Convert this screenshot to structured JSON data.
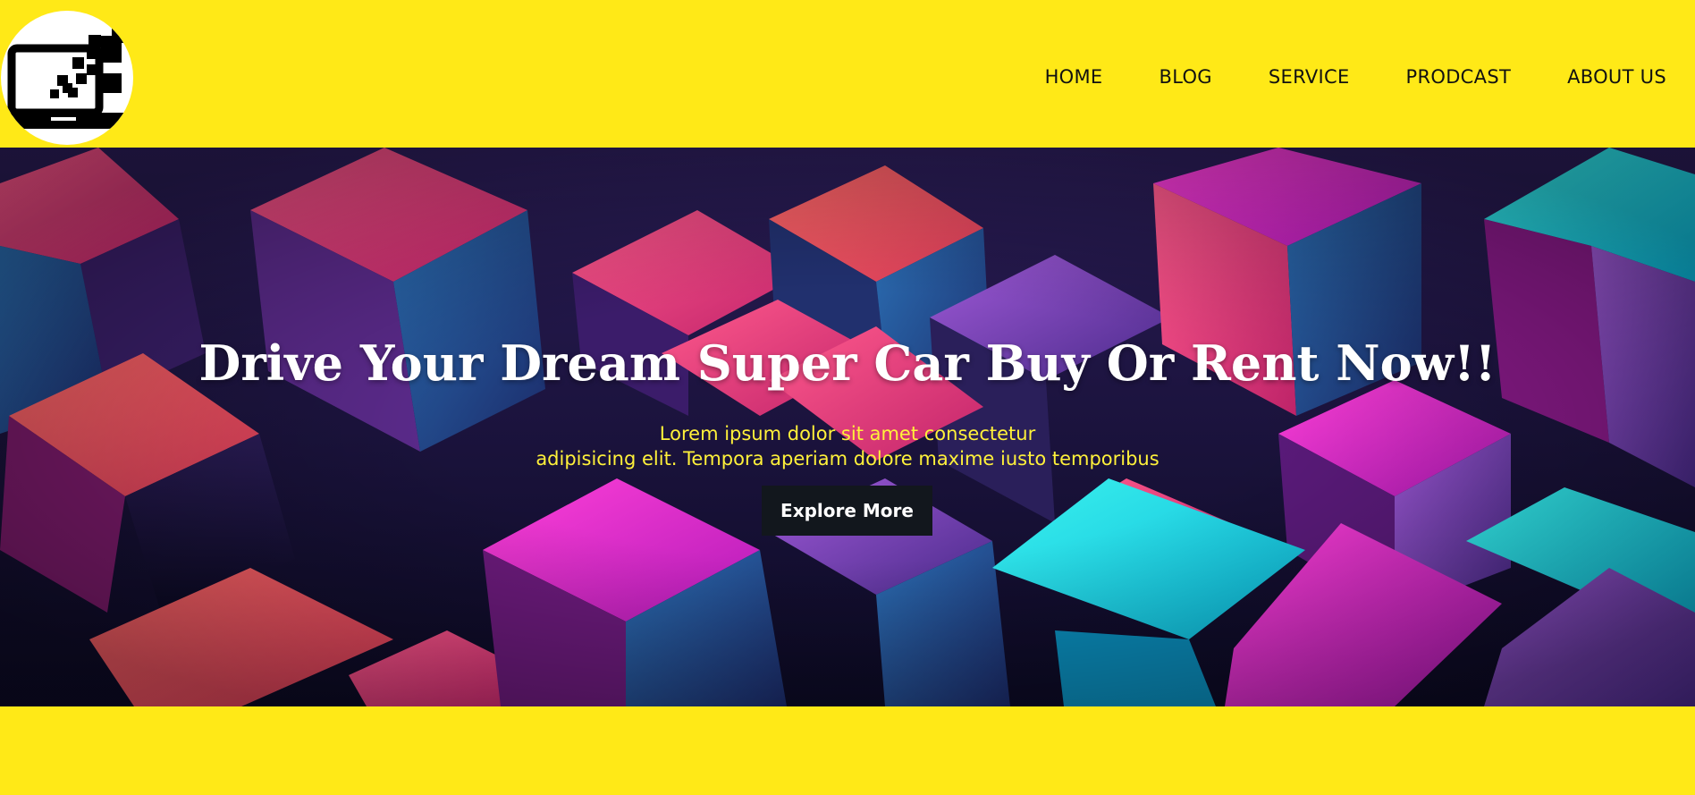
{
  "logo": {
    "icon": "laptop-pixels-icon"
  },
  "nav": {
    "items": [
      {
        "label": "HOME"
      },
      {
        "label": "BLOG"
      },
      {
        "label": "SERVICE"
      },
      {
        "label": "PRODCAST"
      },
      {
        "label": "ABOUT US"
      }
    ]
  },
  "hero": {
    "title": "Drive Your Dream Super Car Buy Or Rent Now!!",
    "subtitle_line1": "Lorem ipsum dolor sit amet consectetur",
    "subtitle_line2": "adipisicing elit. Tempora aperiam dolore maxime iusto temporibus",
    "button_label": "Explore More",
    "background": "abstract-neon-cubes-image"
  },
  "colors": {
    "brand_yellow": "#ffe917",
    "subtitle_yellow": "#fff13a",
    "button_dark": "#12171d",
    "title_white": "#ffffff"
  }
}
